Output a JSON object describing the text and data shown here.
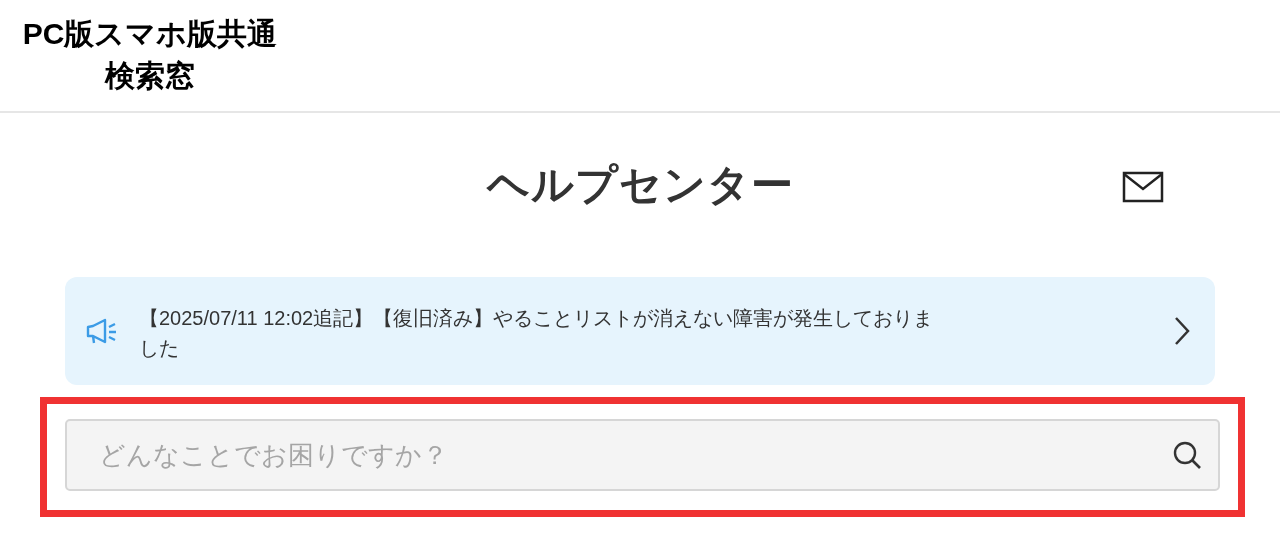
{
  "annotation": {
    "lines": [
      "PC版スマホ版共通",
      "検索窓"
    ]
  },
  "header": {
    "title": "ヘルプセンター"
  },
  "notice": {
    "text": "【2025/07/11 12:02追記】【復旧済み】やることリストが消えない障害が発生しておりました"
  },
  "search": {
    "placeholder": "どんなことでお困りですか？",
    "highlighted": true
  }
}
